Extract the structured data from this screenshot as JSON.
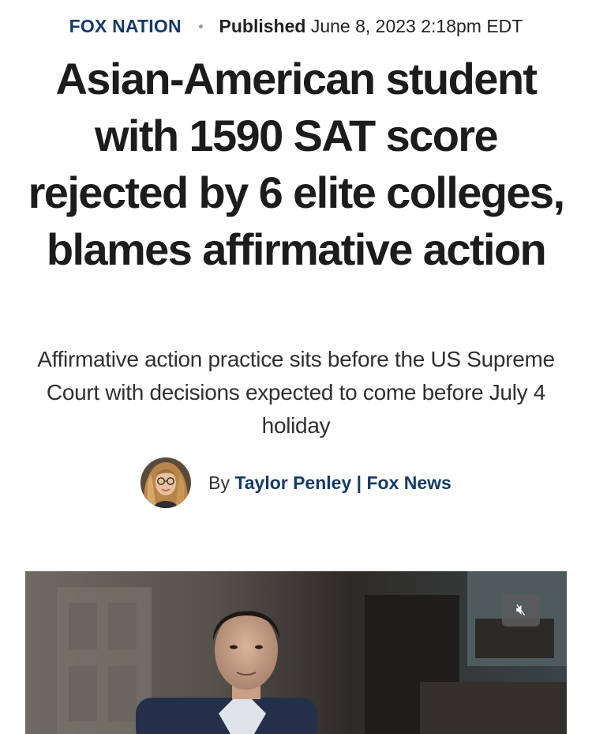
{
  "article": {
    "section": "FOX NATION",
    "published_label": "Published",
    "published_date": "June 8, 2023 2:18pm EDT",
    "headline": "Asian-American student with 1590 SAT score rejected by 6 elite colleges, blames affirmative action",
    "subheadline": "Affirmative action practice sits before the US Supreme Court with decisions expected to come before July 4 holiday",
    "byline_prefix": "By",
    "author": "Taylor Penley | Fox News"
  },
  "video": {
    "mute_icon": "speaker-muted-icon"
  }
}
